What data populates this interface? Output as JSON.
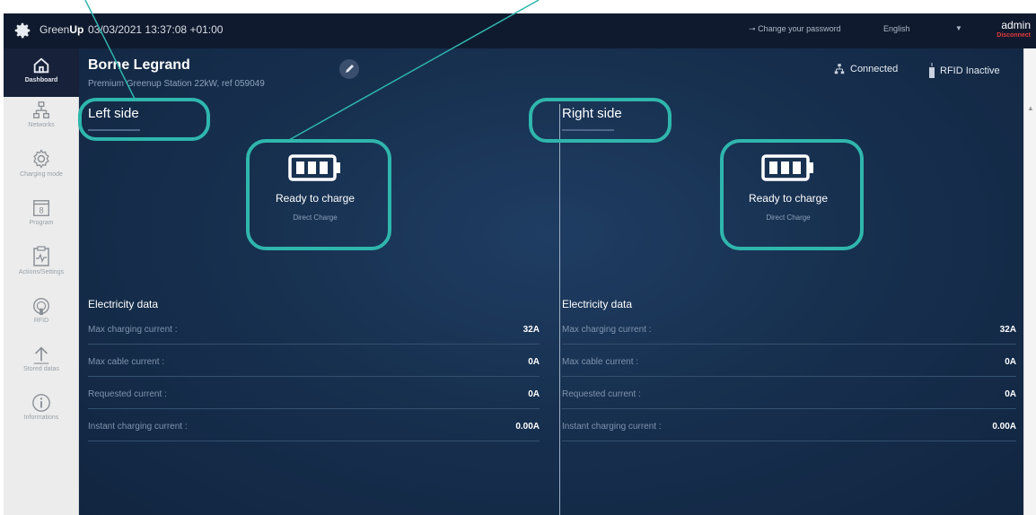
{
  "topbar": {
    "brand_prefix": "Green",
    "brand_suffix": "Up",
    "timestamp": "03/03/2021 13:37:08 +01:00",
    "change_password": "Change your password",
    "language": "English",
    "user": "admin",
    "disconnect": "Disconnect"
  },
  "sidebar": {
    "items": [
      {
        "label": "Dashboard",
        "icon": "home-icon"
      },
      {
        "label": "Networks",
        "icon": "network-icon"
      },
      {
        "label": "Charging mode",
        "icon": "gear-icon"
      },
      {
        "label": "Program",
        "icon": "calendar-icon"
      },
      {
        "label": "Actions/Settings",
        "icon": "activity-icon"
      },
      {
        "label": "RFID",
        "icon": "rfid-icon"
      },
      {
        "label": "Stored datas",
        "icon": "upload-icon"
      },
      {
        "label": "Informations",
        "icon": "info-icon"
      }
    ]
  },
  "header": {
    "title": "Borne Legrand",
    "subtitle": "Premium Greenup Station 22kW, ref 059049",
    "connection_status": "Connected",
    "rfid_status": "RFID Inactive"
  },
  "left": {
    "title": "Left side",
    "state": "Ready to charge",
    "mode": "Direct Charge",
    "electricity_title": "Electricity data",
    "rows": [
      {
        "label": "Max charging current :",
        "value": "32A"
      },
      {
        "label": "Max cable current :",
        "value": "0A"
      },
      {
        "label": "Requested current :",
        "value": "0A"
      },
      {
        "label": "Instant charging current :",
        "value": "0.00A"
      }
    ]
  },
  "right": {
    "title": "Right side",
    "state": "Ready to charge",
    "mode": "Direct Charge",
    "electricity_title": "Electricity data",
    "rows": [
      {
        "label": "Max charging current :",
        "value": "32A"
      },
      {
        "label": "Max cable current :",
        "value": "0A"
      },
      {
        "label": "Requested current :",
        "value": "0A"
      },
      {
        "label": "Instant charging current :",
        "value": "0.00A"
      }
    ]
  },
  "colors": {
    "accent_annotation": "#2fb6ad",
    "topbar_bg": "#101a2e",
    "main_bg": "#17304f",
    "disconnect": "#e23a3a"
  }
}
